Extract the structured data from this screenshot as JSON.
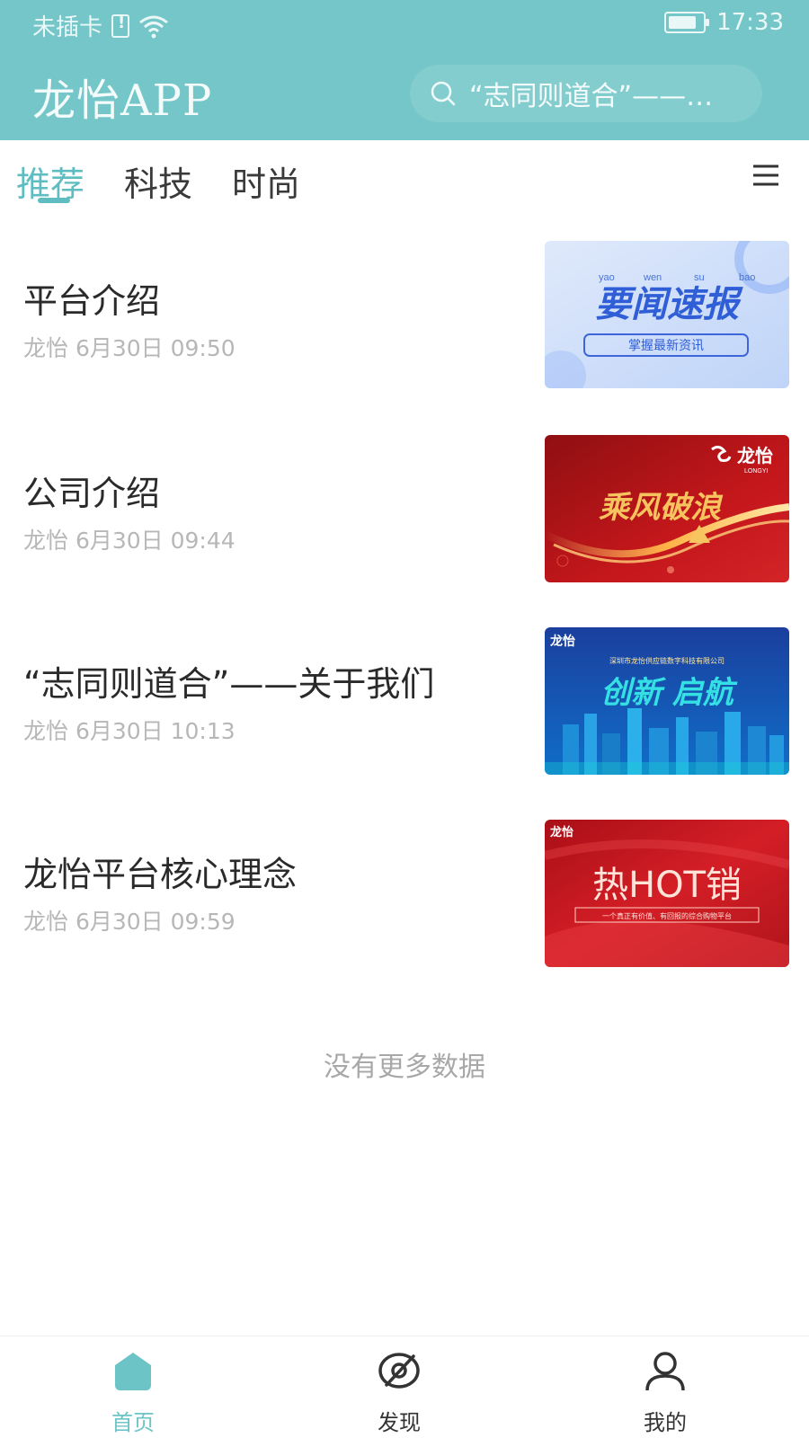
{
  "status_bar": {
    "carrier": "未插卡",
    "time": "17:33"
  },
  "header": {
    "app_title": "龙怡APP",
    "search_placeholder": "“志同则道合”——关于我们"
  },
  "tabs": [
    {
      "label": "推荐",
      "active": true
    },
    {
      "label": "科技",
      "active": false
    },
    {
      "label": "时尚",
      "active": false
    }
  ],
  "news": [
    {
      "title": "平台介绍",
      "meta": "龙怡 6月30日 09:50",
      "image": {
        "pinyin": [
          "yao",
          "wen",
          "su",
          "bao"
        ],
        "headline": "要闻速报",
        "button": "掌握最新资讯"
      }
    },
    {
      "title": "公司介绍",
      "meta": "龙怡 6月30日 09:44",
      "image": {
        "logo": "龙怡",
        "logo_sub": "LONGYI",
        "calligraphy": "乘风破浪"
      }
    },
    {
      "title": "“志同则道合”——关于我们",
      "meta": "龙怡 6月30日 10:13",
      "image": {
        "logo": "龙怡",
        "company": "深圳市龙怡供应链数字科技有限公司",
        "headline": "创新 启航"
      }
    },
    {
      "title": "龙怡平台核心理念",
      "meta": "龙怡 6月30日 09:59",
      "image": {
        "logo": "龙怡",
        "headline": "热HOT销",
        "tagline": "一个真正有价值、有回报的综合购物平台"
      }
    }
  ],
  "footer_text": "没有更多数据",
  "bottom_nav": [
    {
      "label": "首页",
      "active": true
    },
    {
      "label": "发现",
      "active": false
    },
    {
      "label": "我的",
      "active": false
    }
  ],
  "colors": {
    "header": "#74c6c9",
    "accent": "#5fbdc1",
    "meta": "#b7b7b7"
  }
}
